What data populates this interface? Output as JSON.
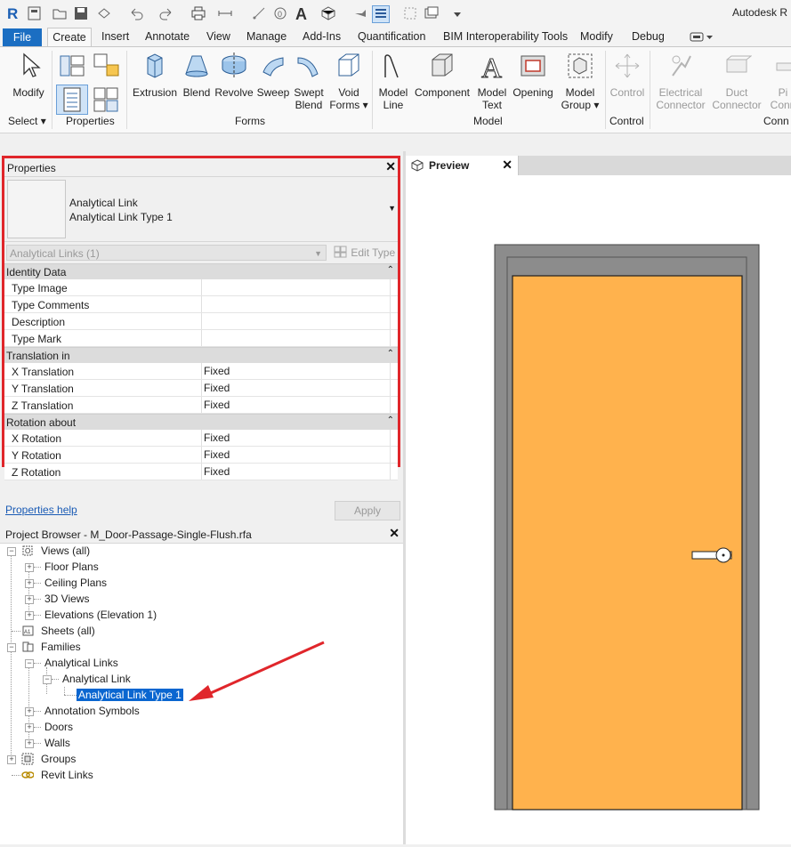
{
  "app": {
    "title": "Autodesk R"
  },
  "ribbon": {
    "tabs": [
      "File",
      "Create",
      "Insert",
      "Annotate",
      "View",
      "Manage",
      "Add-Ins",
      "Quantification",
      "BIM Interoperability Tools",
      "Modify",
      "Debug"
    ],
    "groups": {
      "select": "Select",
      "properties": "Properties",
      "forms": "Forms",
      "model": "Model",
      "control": "Control",
      "connectors": "Conn"
    },
    "buttons": {
      "modify": "Modify",
      "extrusion": "Extrusion",
      "blend": "Blend",
      "revolve": "Revolve",
      "sweep": "Sweep",
      "swept_blend_1": "Swept",
      "swept_blend_2": "Blend",
      "void_forms_1": "Void",
      "void_forms_2": "Forms",
      "model_line_1": "Model",
      "model_line_2": "Line",
      "component": "Component",
      "model_text_1": "Model",
      "model_text_2": "Text",
      "opening": "Opening",
      "model_group_1": "Model",
      "model_group_2": "Group",
      "control": "Control",
      "electrical_connector_1": "Electrical",
      "electrical_connector_2": "Connector",
      "duct_connector_1": "Duct",
      "duct_connector_2": "Connector",
      "pipe_connector_1": "Pi",
      "pipe_connector_2": "Conn"
    }
  },
  "properties": {
    "title": "Properties",
    "type_family": "Analytical Link",
    "type_name": "Analytical Link Type 1",
    "instance_filter": "Analytical Links (1)",
    "edit_type": "Edit Type",
    "categories": [
      {
        "name": "Identity Data",
        "rows": [
          {
            "name": "Type Image",
            "value": ""
          },
          {
            "name": "Type Comments",
            "value": ""
          },
          {
            "name": "Description",
            "value": ""
          },
          {
            "name": "Type Mark",
            "value": ""
          }
        ]
      },
      {
        "name": "Translation in",
        "rows": [
          {
            "name": "X Translation",
            "value": "Fixed"
          },
          {
            "name": "Y Translation",
            "value": "Fixed"
          },
          {
            "name": "Z Translation",
            "value": "Fixed"
          }
        ]
      },
      {
        "name": "Rotation about",
        "rows": [
          {
            "name": "X Rotation",
            "value": "Fixed"
          },
          {
            "name": "Y Rotation",
            "value": "Fixed"
          },
          {
            "name": "Z Rotation",
            "value": "Fixed"
          }
        ]
      }
    ],
    "help_link": "Properties help",
    "apply": "Apply"
  },
  "project_browser": {
    "title": "Project Browser - M_Door-Passage-Single-Flush.rfa",
    "nodes": {
      "views": "Views (all)",
      "floor_plans": "Floor Plans",
      "ceiling_plans": "Ceiling Plans",
      "views_3d": "3D Views",
      "elevations": "Elevations (Elevation 1)",
      "sheets": "Sheets (all)",
      "families": "Families",
      "analytical_links": "Analytical Links",
      "analytical_link": "Analytical Link",
      "analytical_link_type": "Analytical Link Type 1",
      "annotation_symbols": "Annotation Symbols",
      "doors": "Doors",
      "walls": "Walls",
      "groups": "Groups",
      "revit_links": "Revit Links"
    }
  },
  "preview": {
    "tab": "Preview"
  },
  "colors": {
    "door": "#ffb24d",
    "frame": "#8c8c8c",
    "selection": "#0a66d0",
    "annotation": "#e0262b"
  }
}
